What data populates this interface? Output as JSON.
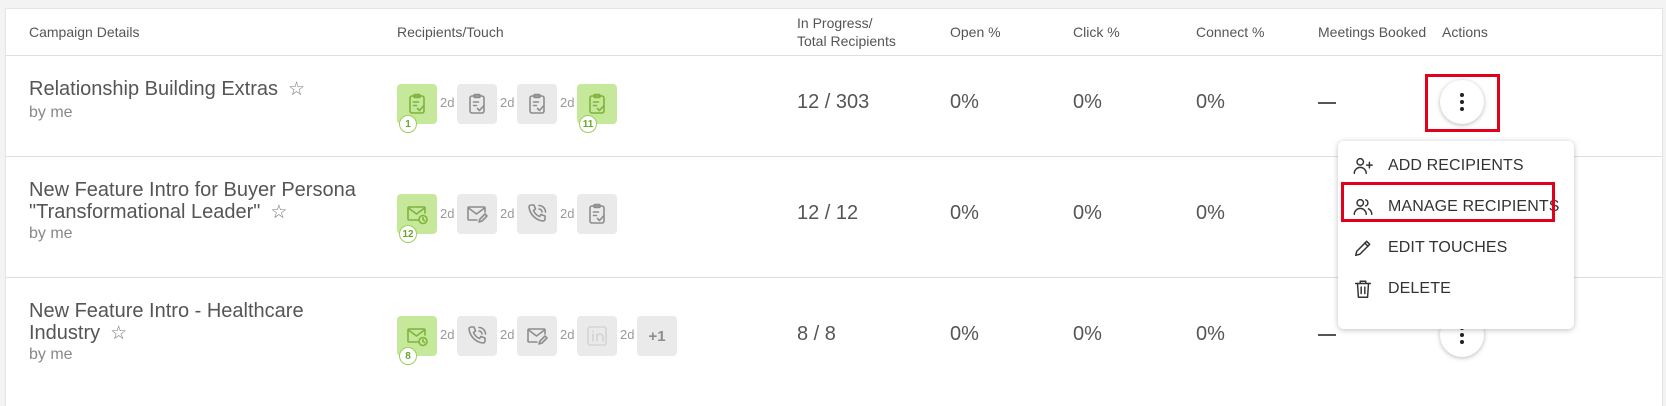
{
  "headers": {
    "campaign": "Campaign Details",
    "recipients_touch": "Recipients/Touch",
    "in_progress_line1": "In Progress/",
    "in_progress_line2": "Total Recipients",
    "open": "Open %",
    "click": "Click %",
    "connect": "Connect %",
    "meetings": "Meetings Booked",
    "actions": "Actions"
  },
  "campaigns": [
    {
      "name": "Relationship Building Extras",
      "owner": "by me",
      "touches": [
        {
          "icon": "task-clipboard-icon",
          "state": "done",
          "badge": "1"
        },
        {
          "icon": "task-clipboard-icon",
          "state": "pending"
        },
        {
          "icon": "task-clipboard-icon",
          "state": "pending"
        },
        {
          "icon": "task-clipboard-icon",
          "state": "done",
          "badge": "11"
        }
      ],
      "delays": [
        "2d",
        "2d",
        "2d"
      ],
      "progress": "12 / 303",
      "open": "0%",
      "click": "0%",
      "connect": "0%",
      "meetings": "dash"
    },
    {
      "name_line1": "New Feature Intro for Buyer Persona",
      "name_line2": "\"Transformational Leader\"",
      "owner": "by me",
      "touches": [
        {
          "icon": "email-clock-icon",
          "state": "done",
          "badge": "12"
        },
        {
          "icon": "email-edit-icon",
          "state": "pending"
        },
        {
          "icon": "phone-icon",
          "state": "pending"
        },
        {
          "icon": "task-clipboard-icon",
          "state": "pending"
        }
      ],
      "delays": [
        "2d",
        "2d",
        "2d"
      ],
      "progress": "12 / 12",
      "open": "0%",
      "click": "0%",
      "connect": "0%"
    },
    {
      "name_line1": "New Feature Intro - Healthcare",
      "name_line2": "Industry",
      "owner": "by me",
      "touches": [
        {
          "icon": "email-clock-icon",
          "state": "done",
          "badge": "8"
        },
        {
          "icon": "phone-icon",
          "state": "pending"
        },
        {
          "icon": "email-edit-icon",
          "state": "pending"
        },
        {
          "icon": "linkedin-icon",
          "state": "pending"
        }
      ],
      "delays": [
        "2d",
        "2d",
        "2d",
        "2d"
      ],
      "more_touches": "+1",
      "progress": "8 / 8",
      "open": "0%",
      "click": "0%",
      "connect": "0%",
      "meetings": "dash"
    }
  ],
  "actions_menu": {
    "items": [
      {
        "label": "ADD RECIPIENTS",
        "icon": "add-user-icon"
      },
      {
        "label": "MANAGE RECIPIENTS",
        "icon": "users-icon",
        "highlighted": true
      },
      {
        "label": "EDIT TOUCHES",
        "icon": "pencil-icon"
      },
      {
        "label": "DELETE",
        "icon": "trash-icon"
      }
    ]
  },
  "colors": {
    "completed_touch": "#c5e89b",
    "pending_touch": "#eaeaea",
    "highlight": "#e3001b"
  }
}
